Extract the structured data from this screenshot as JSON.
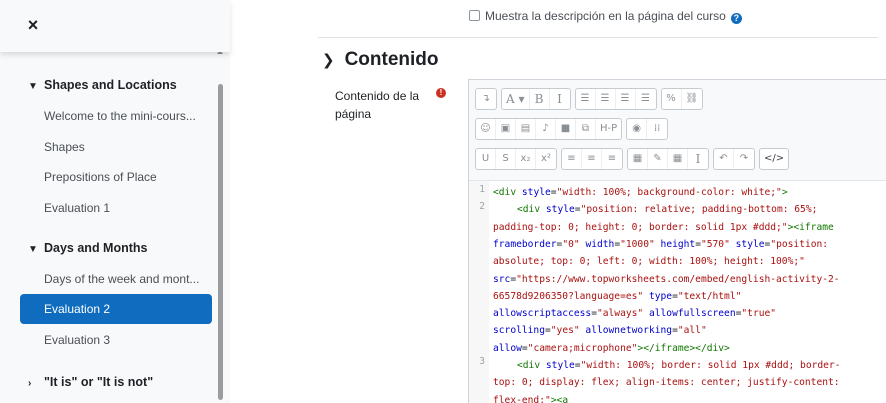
{
  "drawer": {
    "close_icon": "×",
    "sections": [
      {
        "title": "Shapes and Locations",
        "expanded": true,
        "items": [
          "Welcome to the mini-cours...",
          "Shapes",
          "Prepositions of Place",
          "Evaluation 1"
        ]
      },
      {
        "title": "Days and Months",
        "expanded": true,
        "items": [
          "Days of the week and mont...",
          "Evaluation 2",
          "Evaluation 3"
        ]
      },
      {
        "title": "\"It is\" or \"It is not\"",
        "expanded": false,
        "items": []
      }
    ],
    "active_item": "Evaluation 2",
    "accent": "#0f6cbf"
  },
  "main": {
    "top_checkbox_label": "Muestra la descripción en la página del curso",
    "section_title": "Contenido",
    "field_label": "Contenido de la página",
    "required_icon": "!",
    "toolbar": {
      "row1": [
        [
          "↴"
        ],
        [
          "A ▾",
          "B",
          "I"
        ],
        [
          "☰",
          "☰",
          "☰",
          "☰"
        ],
        [
          "%",
          "⛓"
        ]
      ],
      "row2": [
        [
          "☺",
          "▣",
          "▤",
          "♪",
          "■",
          "⧉",
          "H-P"
        ],
        [
          "◉",
          "⁞⁞"
        ]
      ],
      "row3": [
        [
          "U",
          "S",
          "x₂",
          "x²"
        ],
        [
          "≡",
          "≡",
          "≡"
        ],
        [
          "▦",
          "✎",
          "▦",
          "I"
        ],
        [
          "↶",
          "↷"
        ],
        [
          "</>"
        ]
      ]
    },
    "code": {
      "line_numbers": [
        "1",
        "2",
        "3"
      ],
      "lines": [
        [
          [
            "t-tag",
            "<div "
          ],
          [
            "t-attr",
            "style"
          ],
          [
            "t-txt",
            "="
          ],
          [
            "t-str",
            "\"width: 100%; background-color: white;\""
          ],
          [
            "t-tag",
            ">"
          ]
        ],
        [
          [
            "t-tag",
            "<div "
          ],
          [
            "t-attr",
            "style"
          ],
          [
            "t-txt",
            "="
          ],
          [
            "t-str",
            "\"position: relative; padding-bottom: 65%;"
          ]
        ],
        [
          [
            "t-str",
            "padding-top: 0; height: 0; border: solid 1px #ddd;\""
          ],
          [
            "t-tag",
            "><iframe"
          ]
        ],
        [
          [
            "t-attr",
            "frameborder"
          ],
          [
            "t-txt",
            "="
          ],
          [
            "t-str",
            "\"0\" "
          ],
          [
            "t-attr",
            "width"
          ],
          [
            "t-txt",
            "="
          ],
          [
            "t-str",
            "\"1000\" "
          ],
          [
            "t-attr",
            "height"
          ],
          [
            "t-txt",
            "="
          ],
          [
            "t-str",
            "\"570\" "
          ],
          [
            "t-attr",
            "style"
          ],
          [
            "t-txt",
            "="
          ],
          [
            "t-str",
            "\"position:"
          ]
        ],
        [
          [
            "t-str",
            "absolute; top: 0; left: 0; width: 100%; height: 100%;\""
          ]
        ],
        [
          [
            "t-attr",
            "src"
          ],
          [
            "t-txt",
            "="
          ],
          [
            "t-str",
            "\"https://www.topworksheets.com/embed/english-activity-2-"
          ]
        ],
        [
          [
            "t-str",
            "66578d9206350?language=es\" "
          ],
          [
            "t-attr",
            "type"
          ],
          [
            "t-txt",
            "="
          ],
          [
            "t-str",
            "\"text/html\""
          ]
        ],
        [
          [
            "t-attr",
            "allowscriptaccess"
          ],
          [
            "t-txt",
            "="
          ],
          [
            "t-str",
            "\"always\" "
          ],
          [
            "t-attr",
            "allowfullscreen"
          ],
          [
            "t-txt",
            "="
          ],
          [
            "t-str",
            "\"true\""
          ]
        ],
        [
          [
            "t-attr",
            "scrolling"
          ],
          [
            "t-txt",
            "="
          ],
          [
            "t-str",
            "\"yes\" "
          ],
          [
            "t-attr",
            "allownetworking"
          ],
          [
            "t-txt",
            "="
          ],
          [
            "t-str",
            "\"all\""
          ]
        ],
        [
          [
            "t-attr",
            "allow"
          ],
          [
            "t-txt",
            "="
          ],
          [
            "t-str",
            "\"camera;microphone\""
          ],
          [
            "t-tag",
            "></iframe></div>"
          ]
        ],
        [
          [
            "t-tag",
            "<div "
          ],
          [
            "t-attr",
            "style"
          ],
          [
            "t-txt",
            "="
          ],
          [
            "t-str",
            "\"width: 100%; border: solid 1px #ddd; border-"
          ]
        ],
        [
          [
            "t-str",
            "top: 0; display: flex; align-items: center; justify-content:"
          ]
        ],
        [
          [
            "t-str",
            "flex-end;\""
          ],
          [
            "t-tag",
            "><a"
          ]
        ]
      ]
    }
  }
}
